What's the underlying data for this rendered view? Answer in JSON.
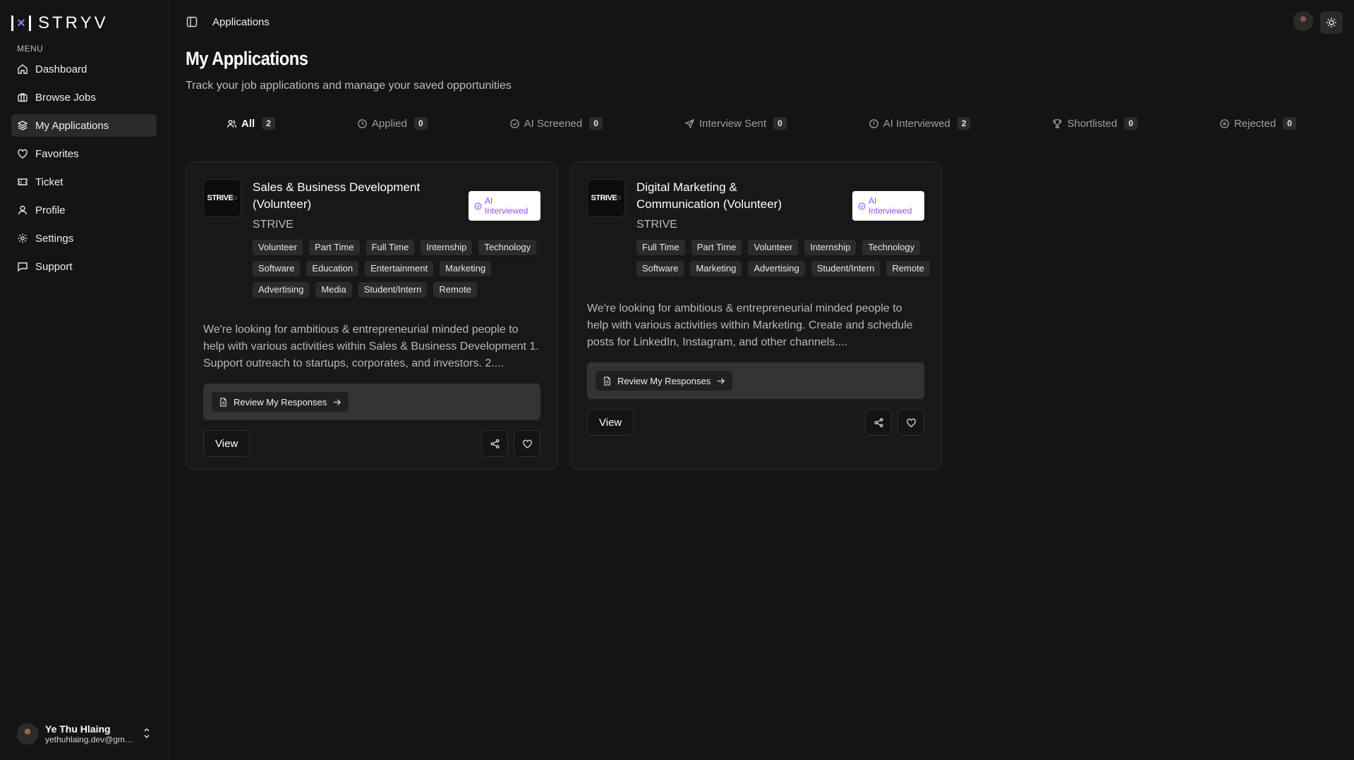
{
  "brand": {
    "name": "STRYV",
    "mark": "[X]"
  },
  "sidebar": {
    "menu_label": "MENU",
    "items": [
      {
        "label": "Dashboard",
        "icon": "home-icon"
      },
      {
        "label": "Browse Jobs",
        "icon": "briefcase-icon"
      },
      {
        "label": "My Applications",
        "icon": "layers-icon",
        "active": true
      },
      {
        "label": "Favorites",
        "icon": "heart-icon"
      },
      {
        "label": "Ticket",
        "icon": "ticket-icon"
      },
      {
        "label": "Profile",
        "icon": "user-icon"
      },
      {
        "label": "Settings",
        "icon": "gear-icon"
      },
      {
        "label": "Support",
        "icon": "message-icon"
      }
    ],
    "user": {
      "name": "Ye Thu Hlaing",
      "email": "yethuhlaing.dev@gmail...."
    }
  },
  "header": {
    "breadcrumb": "Applications"
  },
  "page": {
    "title": "My Applications",
    "subtitle": "Track your job applications and manage your saved opportunities"
  },
  "tabs": [
    {
      "label": "All",
      "count": "2",
      "icon": "users-icon",
      "active": true
    },
    {
      "label": "Applied",
      "count": "0",
      "icon": "clock-icon"
    },
    {
      "label": "AI Screened",
      "count": "0",
      "icon": "check-circle-icon"
    },
    {
      "label": "Interview Sent",
      "count": "0",
      "icon": "send-icon"
    },
    {
      "label": "AI Interviewed",
      "count": "2",
      "icon": "alert-circle-icon"
    },
    {
      "label": "Shortlisted",
      "count": "0",
      "icon": "trophy-icon"
    },
    {
      "label": "Rejected",
      "count": "0",
      "icon": "x-circle-icon"
    }
  ],
  "cards": [
    {
      "title": "Sales & Business Development (Volunteer)",
      "company": "STRIVE",
      "logo_text": "STRIVE",
      "status": "AI Interviewed",
      "tags": [
        "Volunteer",
        "Part Time",
        "Full Time",
        "Internship",
        "Technology",
        "Software",
        "Education",
        "Entertainment",
        "Marketing",
        "Advertising",
        "Media",
        "Student/Intern",
        "Remote"
      ],
      "description": "We're looking for ambitious & entrepreneurial minded people to help with various activities within Sales & Business Development 1. Support outreach to startups, corporates, and investors. 2....",
      "review_label": "Review My Responses",
      "view_label": "View"
    },
    {
      "title": "Digital Marketing & Communication (Volunteer)",
      "company": "STRIVE",
      "logo_text": "STRIVE",
      "status": "AI Interviewed",
      "tags": [
        "Full Time",
        "Part Time",
        "Volunteer",
        "Internship",
        "Technology",
        "Software",
        "Marketing",
        "Advertising",
        "Student/Intern",
        "Remote"
      ],
      "description": "We're looking for ambitious & entrepreneurial minded people to help with various activities within Marketing. Create and schedule posts for LinkedIn, Instagram, and other channels....",
      "review_label": "Review My Responses",
      "view_label": "View"
    }
  ],
  "colors": {
    "accent": "#8a4fff",
    "background": "#141414",
    "card": "#181818"
  }
}
